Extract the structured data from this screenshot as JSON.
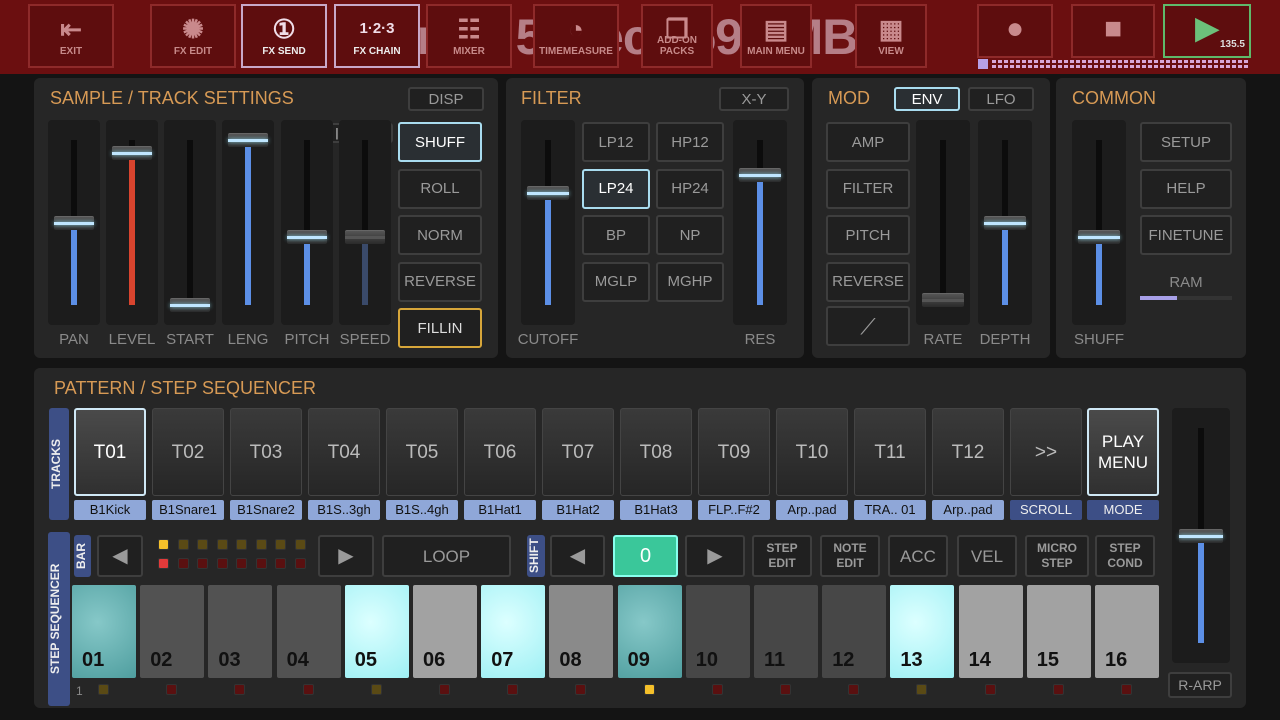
{
  "toolbar": {
    "buttons": [
      {
        "label": "EXIT",
        "icon": "exit-door-icon",
        "glyph": "⇤"
      },
      {
        "label": "FX EDIT",
        "icon": "fx-sun-icon",
        "glyph": "✺"
      },
      {
        "label": "FX SEND",
        "icon": "fx-send-icon",
        "glyph": "①"
      },
      {
        "label": "FX CHAIN",
        "icon": "fx-chain-icon",
        "glyph": "1·2·3"
      },
      {
        "label": "MIXER",
        "icon": "mixer-icon",
        "glyph": "☷"
      },
      {
        "label": "TIMEMEASURE",
        "icon": "gauge-icon",
        "glyph": "◔"
      },
      {
        "label": "ADD-ON PACKS",
        "icon": "box-icon",
        "glyph": "❒"
      },
      {
        "label": "MAIN MENU",
        "icon": "drawer-icon",
        "glyph": "▤"
      },
      {
        "label": "VIEW",
        "icon": "grid-icon",
        "glyph": "▦"
      }
    ],
    "record_icon": "record-icon",
    "stop_icon": "stop-icon",
    "play_icon": "play-icon",
    "tempo": "135.5",
    "overlay": "5min 56sec / 59.9MB"
  },
  "sample": {
    "title": "SAMPLE / TRACK SETTINGS",
    "disp": "DISP",
    "faders": [
      {
        "label": "PAN",
        "value": 0.5
      },
      {
        "label": "LEVEL",
        "value": 0.92
      },
      {
        "label": "START",
        "value": 0.0
      },
      {
        "label": "LENG",
        "value": 1.0
      },
      {
        "label": "PITCH",
        "value": 0.41
      },
      {
        "label": "SPEED",
        "value": 0.41
      }
    ],
    "arrows": "◂ | ▸",
    "buttons": [
      "SHUFF",
      "ROLL",
      "NORM",
      "REVERSE",
      "FILLIN"
    ]
  },
  "filter": {
    "title": "FILTER",
    "xy": "X-Y",
    "cutoff": {
      "label": "CUTOFF",
      "value": 0.68
    },
    "res": {
      "label": "RES",
      "value": 0.79
    },
    "types": [
      "LP12",
      "HP12",
      "LP24",
      "HP24",
      "BP",
      "NP",
      "MGLP",
      "MGHP"
    ],
    "selected": "LP24"
  },
  "mod": {
    "title": "MOD",
    "env": "ENV",
    "lfo": "LFO",
    "buttons": [
      "AMP",
      "FILTER",
      "PITCH",
      "REVERSE"
    ],
    "shape_icon": "ramp-shape-icon",
    "rate": {
      "label": "RATE",
      "value": 0.03
    },
    "depth": {
      "label": "DEPTH",
      "value": 0.5
    }
  },
  "common": {
    "title": "COMMON",
    "shuff": {
      "label": "SHUFF",
      "value": 0.41
    },
    "buttons": [
      "SETUP",
      "HELP",
      "FINETUNE"
    ],
    "ram_label": "RAM",
    "ram_usage": 0.4
  },
  "pattern": {
    "title": "PATTERN / STEP SEQUENCER",
    "tracks_tab": "TRACKS",
    "tracks": [
      {
        "id": "T01",
        "name": "B1Kick"
      },
      {
        "id": "T02",
        "name": "B1Snare1"
      },
      {
        "id": "T03",
        "name": "B1Snare2"
      },
      {
        "id": "T04",
        "name": "B1S..3gh"
      },
      {
        "id": "T05",
        "name": "B1S..4gh"
      },
      {
        "id": "T06",
        "name": "B1Hat1"
      },
      {
        "id": "T07",
        "name": "B1Hat2"
      },
      {
        "id": "T08",
        "name": "B1Hat3"
      },
      {
        "id": "T09",
        "name": "FLP..F#2"
      },
      {
        "id": "T10",
        "name": "Arp..pad"
      },
      {
        "id": "T11",
        "name": "TRA.. 01"
      },
      {
        "id": "T12",
        "name": "Arp..pad"
      }
    ],
    "scroll": {
      "label": ">>",
      "sub": "SCROLL"
    },
    "play_menu": {
      "label": "PLAY MENU",
      "sub": "MODE"
    },
    "master_fader": 0.5,
    "rarp": "R-ARP"
  },
  "sequencer": {
    "tab": "STEP SEQUENCER",
    "bar_tab": "BAR",
    "shift_tab": "SHIFT",
    "loop": "LOOP",
    "shift_value": "0",
    "buttons": [
      "STEP EDIT",
      "NOTE EDIT",
      "ACC",
      "VEL",
      "MICRO STEP",
      "STEP COND"
    ],
    "bar_index": "1",
    "steps": [
      {
        "n": "01",
        "state": "cur"
      },
      {
        "n": "02",
        "state": "dk"
      },
      {
        "n": "03",
        "state": "dk"
      },
      {
        "n": "04",
        "state": "dk"
      },
      {
        "n": "05",
        "state": "on"
      },
      {
        "n": "06",
        "state": "lt"
      },
      {
        "n": "07",
        "state": "on"
      },
      {
        "n": "08",
        "state": "gr"
      },
      {
        "n": "09",
        "state": "cur"
      },
      {
        "n": "10",
        "state": "dk2"
      },
      {
        "n": "11",
        "state": "dk2"
      },
      {
        "n": "12",
        "state": "dk2"
      },
      {
        "n": "13",
        "state": "on"
      },
      {
        "n": "14",
        "state": "lt"
      },
      {
        "n": "15",
        "state": "lt"
      },
      {
        "n": "16",
        "state": "lt"
      }
    ],
    "step_markers": [
      "y",
      "r",
      "r",
      "r",
      "y",
      "r",
      "r",
      "r",
      "Y",
      "r",
      "r",
      "r",
      "y",
      "r",
      "r",
      "r"
    ]
  }
}
